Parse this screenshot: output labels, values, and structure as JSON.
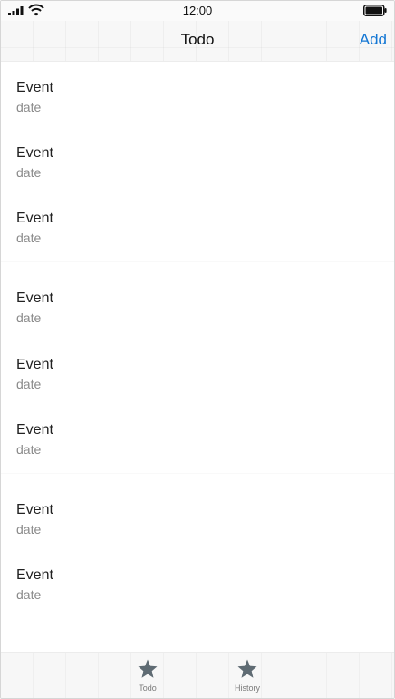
{
  "status_bar": {
    "time": "12:00",
    "signal_icon": "signal-bars-icon",
    "wifi_icon": "wifi-icon",
    "battery_icon": "battery-icon"
  },
  "nav": {
    "title": "Todo",
    "add_label": "Add"
  },
  "list": {
    "items": [
      {
        "title": "Event",
        "subtitle": "date"
      },
      {
        "title": "Event",
        "subtitle": "date"
      },
      {
        "title": "Event",
        "subtitle": "date"
      },
      {
        "title": "Event",
        "subtitle": "date"
      },
      {
        "title": "Event",
        "subtitle": "date"
      },
      {
        "title": "Event",
        "subtitle": "date"
      },
      {
        "title": "Event",
        "subtitle": "date"
      },
      {
        "title": "Event",
        "subtitle": "date"
      }
    ]
  },
  "tab_bar": {
    "tabs": [
      {
        "label": "Todo",
        "icon": "star-icon"
      },
      {
        "label": "History",
        "icon": "star-icon"
      }
    ]
  },
  "colors": {
    "accent": "#1477d4",
    "tab_icon": "#5f6b73",
    "subtitle": "#8a8a8a"
  }
}
